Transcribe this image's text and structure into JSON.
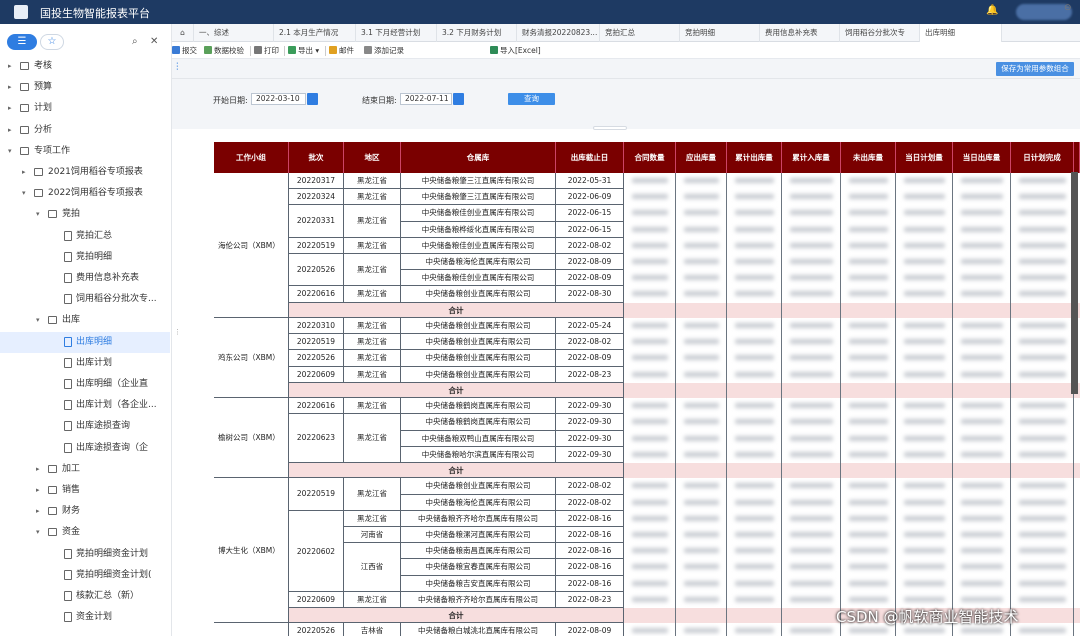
{
  "app": {
    "title": "国投生物智能报表平台"
  },
  "sidebar": {
    "tree": [
      {
        "label": "考核",
        "level": 0,
        "type": "folder",
        "expanded": false
      },
      {
        "label": "预算",
        "level": 0,
        "type": "folder",
        "expanded": false
      },
      {
        "label": "计划",
        "level": 0,
        "type": "folder",
        "expanded": false
      },
      {
        "label": "分析",
        "level": 0,
        "type": "folder",
        "expanded": false
      },
      {
        "label": "专项工作",
        "level": 0,
        "type": "folder",
        "expanded": true
      },
      {
        "label": "2021饲用稻谷专项报表",
        "level": 1,
        "type": "folder",
        "expanded": false
      },
      {
        "label": "2022饲用稻谷专项报表",
        "level": 1,
        "type": "folder",
        "expanded": true
      },
      {
        "label": "竞拍",
        "level": 2,
        "type": "folder",
        "expanded": true
      },
      {
        "label": "竞拍汇总",
        "level": 3,
        "type": "doc"
      },
      {
        "label": "竞拍明细",
        "level": 3,
        "type": "doc"
      },
      {
        "label": "费用信息补充表",
        "level": 3,
        "type": "doc"
      },
      {
        "label": "饲用稻谷分批次专...",
        "level": 3,
        "type": "doc"
      },
      {
        "label": "出库",
        "level": 2,
        "type": "folder",
        "expanded": true
      },
      {
        "label": "出库明细",
        "level": 3,
        "type": "doc",
        "active": true
      },
      {
        "label": "出库计划",
        "level": 3,
        "type": "doc"
      },
      {
        "label": "出库明细（企业直",
        "level": 3,
        "type": "doc"
      },
      {
        "label": "出库计划（各企业...",
        "level": 3,
        "type": "doc"
      },
      {
        "label": "出库途损查询",
        "level": 3,
        "type": "doc"
      },
      {
        "label": "出库途损查询（企",
        "level": 3,
        "type": "doc"
      },
      {
        "label": "加工",
        "level": 2,
        "type": "folder",
        "expanded": false
      },
      {
        "label": "销售",
        "level": 2,
        "type": "folder",
        "expanded": false
      },
      {
        "label": "财务",
        "level": 2,
        "type": "folder",
        "expanded": false
      },
      {
        "label": "资金",
        "level": 2,
        "type": "folder",
        "expanded": true
      },
      {
        "label": "竞拍明细资金计划",
        "level": 3,
        "type": "doc"
      },
      {
        "label": "竞拍明细资金计划(",
        "level": 3,
        "type": "doc"
      },
      {
        "label": "核款汇总（新）",
        "level": 3,
        "type": "doc"
      },
      {
        "label": "资金计划",
        "level": 3,
        "type": "doc"
      }
    ]
  },
  "tabs": [
    "一、综述",
    "2.1 本月生产情况",
    "3.1 下月经营计划",
    "3.2 下月财务计划",
    "财务清报20220823...",
    "竞拍汇总",
    "竞拍明细",
    "费用信息补充表",
    "饲用稻谷分批次专",
    "出库明细"
  ],
  "toolbar": {
    "submit": "报交",
    "check": "数据校验",
    "print": "打印",
    "export": "导出",
    "mail": "邮件",
    "add_record": "添加记录",
    "import": "导入[Excel]"
  },
  "params": {
    "save_label": "保存为常用参数组合",
    "start_label": "开始日期:",
    "start_value": "2022-03-10",
    "end_label": "结束日期:",
    "end_value": "2022-07-11",
    "query_label": "查询"
  },
  "table": {
    "headers": [
      "工作小组",
      "批次",
      "地区",
      "仓属库",
      "出库截止日",
      "合同数量",
      "应出库量",
      "累计出库量",
      "累计入库量",
      "未出库量",
      "当日计划量",
      "当日出库量",
      "日计划完成"
    ],
    "groups": [
      {
        "name": "海伦公司（XBM）",
        "rows": [
          {
            "batch": "20220317",
            "region": "黑龙江省",
            "depot": "中央储备粮肇三江直属库有限公司",
            "date": "2022-05-31"
          },
          {
            "batch": "20220324",
            "region": "黑龙江省",
            "depot": "中央储备粮肇三江直属库有限公司",
            "date": "2022-06-09"
          },
          {
            "batch": "20220331",
            "region": "黑龙江省",
            "depot": "中央储备粮佳创业直属库有限公司",
            "date": "2022-06-15"
          },
          {
            "batch": "20220331",
            "region": "黑龙江省",
            "depot": "中央储备粮桦绥化直属库有限公司",
            "date": "2022-06-15"
          },
          {
            "batch": "20220519",
            "region": "黑龙江省",
            "depot": "中央储备粮佳创业直属库有限公司",
            "date": "2022-08-02"
          },
          {
            "batch": "20220526",
            "region": "黑龙江省",
            "depot": "中央储备粮海伦直属库有限公司",
            "date": "2022-08-09"
          },
          {
            "batch": "20220526",
            "region": "黑龙江省",
            "depot": "中央储备粮佳创业直属库有限公司",
            "date": "2022-08-09"
          },
          {
            "batch": "20220616",
            "region": "黑龙江省",
            "depot": "中央储备粮创业直属库有限公司",
            "date": "2022-08-30"
          }
        ]
      },
      {
        "name": "鸡东公司（XBM）",
        "rows": [
          {
            "batch": "20220310",
            "region": "黑龙江省",
            "depot": "中央储备粮创业直属库有限公司",
            "date": "2022-05-24"
          },
          {
            "batch": "20220519",
            "region": "黑龙江省",
            "depot": "中央储备粮创业直属库有限公司",
            "date": "2022-08-02"
          },
          {
            "batch": "20220526",
            "region": "黑龙江省",
            "depot": "中央储备粮创业直属库有限公司",
            "date": "2022-08-09"
          },
          {
            "batch": "20220609",
            "region": "黑龙江省",
            "depot": "中央储备粮创业直属库有限公司",
            "date": "2022-08-23"
          }
        ]
      },
      {
        "name": "榆树公司（XBM）",
        "rows": [
          {
            "batch": "20220616",
            "region": "黑龙江省",
            "depot": "中央储备粮鹤岗直属库有限公司",
            "date": "2022-09-30"
          },
          {
            "batch": "20220623",
            "region": "黑龙江省",
            "depot": "中央储备粮鹤岗直属库有限公司",
            "date": "2022-09-30"
          },
          {
            "batch": "20220623",
            "region": "黑龙江省",
            "depot": "中央储备粮双鸭山直属库有限公司",
            "date": "2022-09-30"
          },
          {
            "batch": "20220623",
            "region": "黑龙江省",
            "depot": "中央储备粮哈尔滨直属库有限公司",
            "date": "2022-09-30"
          }
        ]
      },
      {
        "name": "博大生化（XBM）",
        "rows": [
          {
            "batch": "20220519",
            "region": "黑龙江省",
            "depot": "中央储备粮创业直属库有限公司",
            "date": "2022-08-02"
          },
          {
            "batch": "20220519",
            "region": "黑龙江省",
            "depot": "中央储备粮海伦直属库有限公司",
            "date": "2022-08-02"
          },
          {
            "batch": "20220602",
            "region": "黑龙江省",
            "depot": "中央储备粮齐齐哈尔直属库有限公司",
            "date": "2022-08-16"
          },
          {
            "batch": "20220602",
            "region": "河南省",
            "depot": "中央储备粮漯河直属库有限公司",
            "date": "2022-08-16"
          },
          {
            "batch": "20220602",
            "region": "江西省",
            "depot": "中央储备粮南昌直属库有限公司",
            "date": "2022-08-16"
          },
          {
            "batch": "20220602",
            "region": "江西省",
            "depot": "中央储备粮宜春直属库有限公司",
            "date": "2022-08-16"
          },
          {
            "batch": "20220602",
            "region": "江西省",
            "depot": "中央储备粮吉安直属库有限公司",
            "date": "2022-08-16"
          },
          {
            "batch": "20220609",
            "region": "黑龙江省",
            "depot": "中央储备粮齐齐哈尔直属库有限公司",
            "date": "2022-08-23"
          }
        ]
      },
      {
        "name": "",
        "rows": [
          {
            "batch": "20220526",
            "region": "吉林省",
            "depot": "中央储备粮白城洮北直属库有限公司",
            "date": "2022-08-09"
          },
          {
            "batch": "20220616",
            "region": "黑龙江省",
            "depot": "中央储备粮鹤岗直属库有限公司",
            "date": "2022-08-30"
          }
        ]
      }
    ],
    "subtotal_label": "合计"
  },
  "watermark": "CSDN @帆软商业智能技术",
  "colors": {
    "topbar": "#1e3a63",
    "header": "#7a0000",
    "subtotal": "#f7dede",
    "accent": "#2f7de1"
  }
}
